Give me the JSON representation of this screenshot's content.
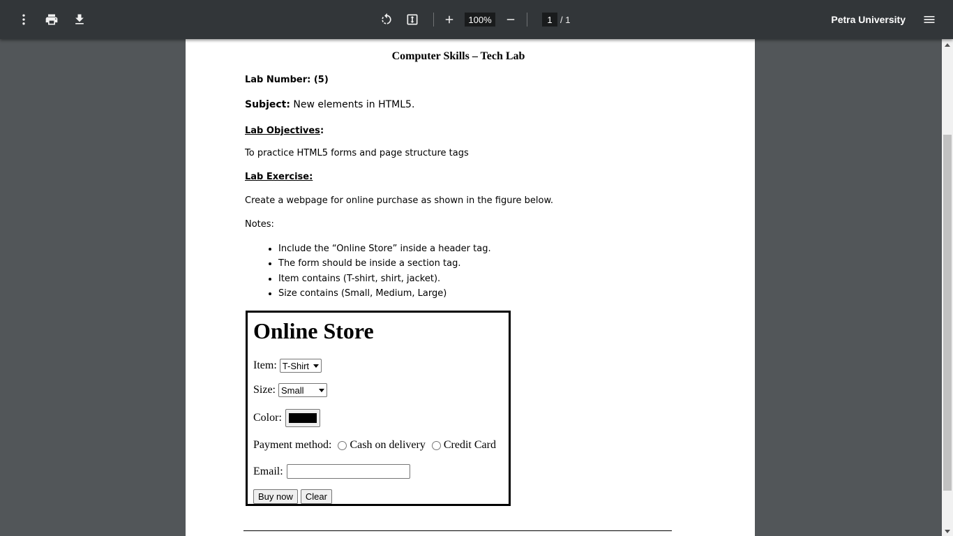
{
  "toolbar": {
    "menu_icon": "more-vert-icon",
    "print_icon": "print-icon",
    "download_icon": "download-icon",
    "rotate_icon": "rotate-icon",
    "fit_icon": "fit-page-icon",
    "zoom_in_icon": "plus-icon",
    "zoom_level": "100%",
    "zoom_out_icon": "minus-icon",
    "page_current": "1",
    "page_total": "/  1",
    "doc_title": "Petra University",
    "outline_icon": "hamburger-icon"
  },
  "doc": {
    "title": "Computer Skills – Tech Lab",
    "lab_number_label": "Lab Number: (5)",
    "subject_label": "Subject:",
    "subject_value": " New elements in HTML5.",
    "objectives_label": " Lab Objectives",
    "objectives_colon": ":",
    "objectives_text": "To practice HTML5 forms and page structure tags",
    "exercise_label": "Lab Exercise:",
    "exercise_text": "Create a webpage for online purchase as shown in the figure below.",
    "notes_label": "Notes:",
    "notes": [
      "Include the “Online Store” inside a header tag.",
      "The form should be inside a section tag.",
      "Item contains (T-shirt, shirt, jacket).",
      "Size contains (Small, Medium, Large)"
    ]
  },
  "figure": {
    "heading": "Online Store",
    "item_label": "Item:",
    "item_value": "T-Shirt",
    "size_label": "Size:",
    "size_value": "Small",
    "color_label": "Color:",
    "color_value": "#000000",
    "payment_label": "Payment method:",
    "payment_options": [
      "Cash on delivery",
      "Credit Card"
    ],
    "email_label": "Email:",
    "buy_label": "Buy now",
    "clear_label": "Clear"
  }
}
